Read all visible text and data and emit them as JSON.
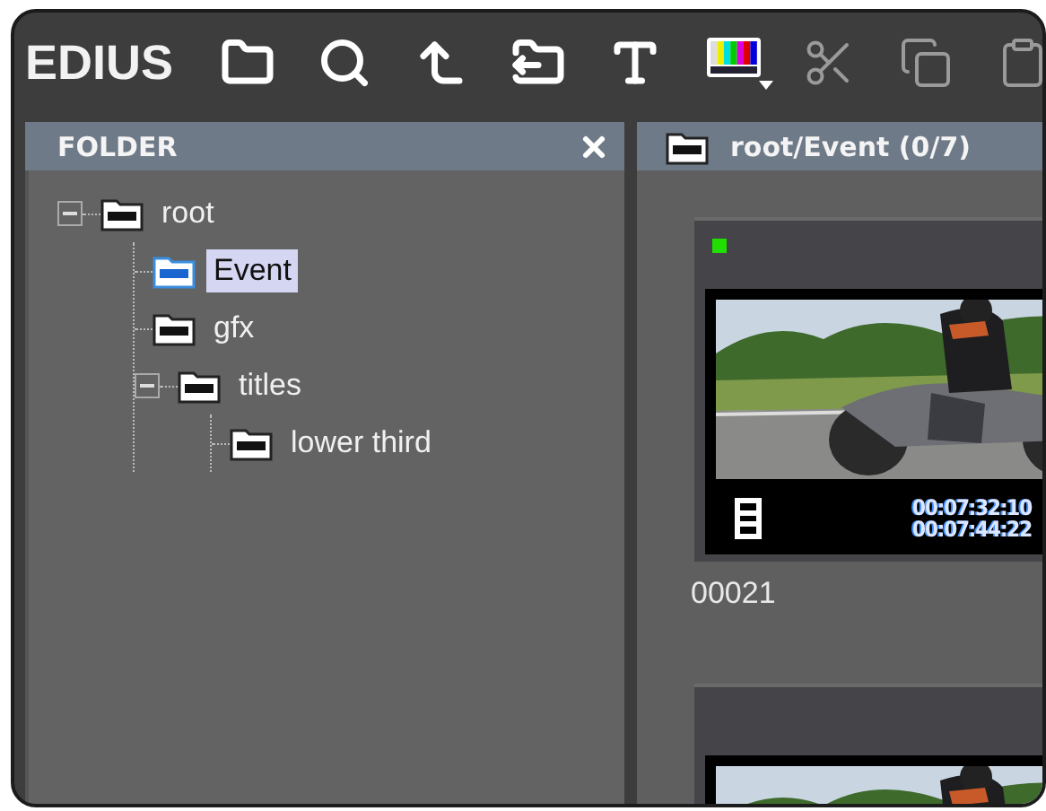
{
  "app": {
    "logo": "EDIUS"
  },
  "toolbar": [
    {
      "kind": "folder",
      "disabled": false
    },
    {
      "kind": "search",
      "disabled": false
    },
    {
      "kind": "up",
      "disabled": false
    },
    {
      "kind": "export",
      "disabled": false
    },
    {
      "kind": "text",
      "disabled": false
    },
    {
      "kind": "bars",
      "disabled": false
    },
    {
      "kind": "cut",
      "disabled": true
    },
    {
      "kind": "copy",
      "disabled": true
    },
    {
      "kind": "paste",
      "disabled": true
    }
  ],
  "folder_panel": {
    "title": "FOLDER",
    "tree": [
      {
        "label": "root",
        "expanded": true,
        "selected": false,
        "children": [
          {
            "label": "Event",
            "selected": true
          },
          {
            "label": "gfx",
            "selected": false
          },
          {
            "label": "titles",
            "expanded": true,
            "selected": false,
            "children": [
              {
                "label": "lower third",
                "selected": false
              }
            ]
          }
        ]
      }
    ]
  },
  "bin_panel": {
    "path": "root/Event (0/7)",
    "clips": [
      {
        "kind": "picture",
        "name": "00021",
        "color": "#22dd00",
        "timecode_in": "00:07:32:10",
        "timecode_out": "00:07:44:22"
      },
      {
        "kind": "picture"
      }
    ]
  }
}
